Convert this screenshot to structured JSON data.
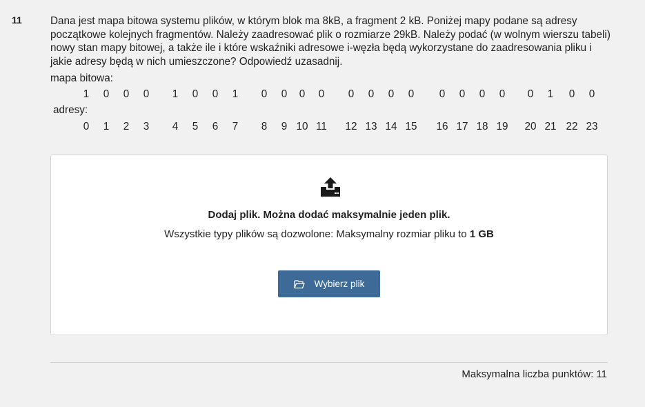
{
  "question": {
    "number": "11",
    "text": "Dana jest mapa bitowa systemu plików, w którym blok ma 8kB, a fragment 2 kB. Poniżej mapy podane są adresy początkowe kolejnych fragmentów. Należy zaadresować plik o rozmiarze 29kB. Należy podać (w wolnym wierszu tabeli) nowy stan mapy bitowej, a także ile i które wskaźniki adresowe i-węzła będą wykorzystane do zaadresowania pliku i jakie adresy  będą  w nich umieszczone? Odpowiedź uzasadnij.",
    "bitmap_label": "mapa bitowa:",
    "bits": [
      "1",
      "0",
      "0",
      "0",
      "1",
      "0",
      "0",
      "1",
      "0",
      "0",
      "0",
      "0",
      "0",
      "0",
      "0",
      "0",
      "0",
      "0",
      "0",
      "0",
      "0",
      "1",
      "0",
      "0"
    ],
    "addresses_label": "adresy:",
    "addresses": [
      "0",
      "1",
      "2",
      "3",
      "4",
      "5",
      "6",
      "7",
      "8",
      "9",
      "10",
      "11",
      "12",
      "13",
      "14",
      "15",
      "16",
      "17",
      "18",
      "19",
      "20",
      "21",
      "22",
      "23"
    ]
  },
  "upload": {
    "icon": "upload-icon",
    "title": "Dodaj plik. Można dodać maksymalnie jeden plik.",
    "info_prefix": "Wszystkie typy plików są dozwolone: Maksymalny rozmiar pliku to ",
    "info_size": "1 GB",
    "button_icon": "folder-open-icon",
    "button_label": "Wybierz plik",
    "button_color": "#3d6a97"
  },
  "footer": {
    "max_points": "Maksymalna liczba punktów: 11"
  }
}
